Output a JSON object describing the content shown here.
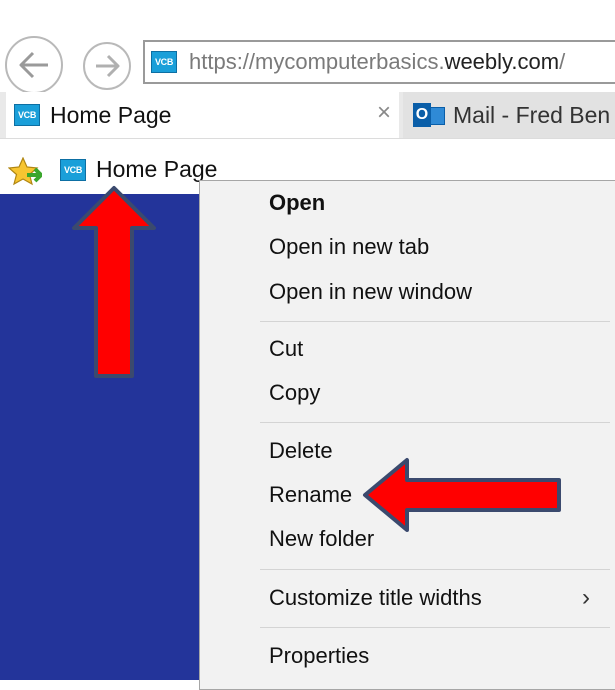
{
  "address_bar": {
    "site_icon": "VCB",
    "url_prefix": "https://",
    "url_domain_part1": "mycomputerbasics.",
    "url_domain_part2": "weebly.com",
    "url_suffix": "/"
  },
  "tabs": [
    {
      "icon": "VCB",
      "label": "Home Page",
      "close_glyph": "×"
    },
    {
      "icon": "outlook-icon",
      "label": "Mail - Fred Ben"
    }
  ],
  "favorites_bar": {
    "item_icon": "VCB",
    "item_label": "Home Page"
  },
  "context_menu": {
    "items": [
      {
        "label": "Open"
      },
      {
        "label": "Open in new tab"
      },
      {
        "label": "Open in new window"
      },
      {
        "label": "Cut"
      },
      {
        "label": "Copy"
      },
      {
        "label": "Delete"
      },
      {
        "label": "Rename"
      },
      {
        "label": "New folder"
      },
      {
        "label": "Customize title widths",
        "submenu_glyph": "›"
      },
      {
        "label": "Properties"
      }
    ]
  },
  "colors": {
    "page_background": "#23349a",
    "annotation_arrow_fill": "#ff0000",
    "annotation_arrow_border": "#3b4a6e",
    "site_icon_blue": "#1a9fd9"
  }
}
